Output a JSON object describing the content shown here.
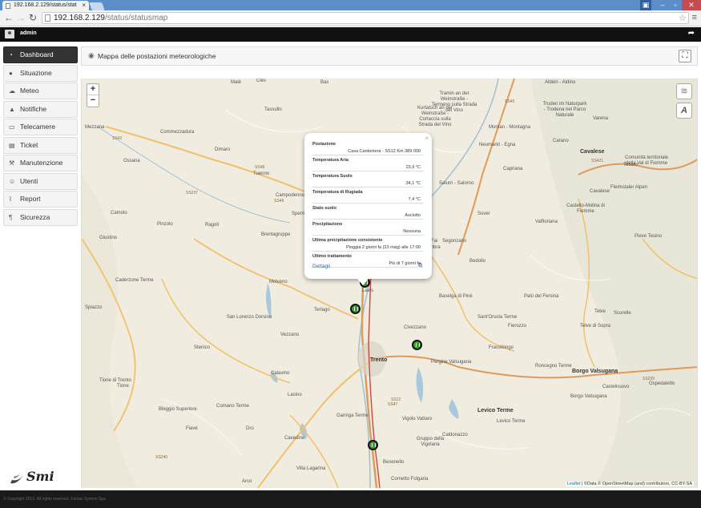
{
  "browser": {
    "tab_title": "192.168.2.129/status/stat",
    "tab_close": "×",
    "url_host": "192.168.2.129",
    "url_path": "/status/statusmap"
  },
  "app": {
    "username": "admin"
  },
  "sidebar": {
    "items": [
      {
        "label": "Dashboard",
        "icon": "dashboard-icon",
        "glyph": "◔"
      },
      {
        "label": "Situazione",
        "icon": "map-pin-icon",
        "glyph": "●"
      },
      {
        "label": "Meteo",
        "icon": "cloud-icon",
        "glyph": "☁"
      },
      {
        "label": "Notifiche",
        "icon": "warning-icon",
        "glyph": "▲"
      },
      {
        "label": "Telecamere",
        "icon": "camera-icon",
        "glyph": "▭"
      },
      {
        "label": "Ticket",
        "icon": "ticket-icon",
        "glyph": "▤"
      },
      {
        "label": "Manutenzione",
        "icon": "tools-icon",
        "glyph": "⚒"
      },
      {
        "label": "Utenti",
        "icon": "users-icon",
        "glyph": "☺"
      },
      {
        "label": "Report",
        "icon": "chart-icon",
        "glyph": "⌇"
      },
      {
        "label": "Sicurezza",
        "icon": "shield-icon",
        "glyph": "¶"
      }
    ]
  },
  "brand": {
    "name": "Smi"
  },
  "panel": {
    "title": "Mappa delle postazioni meteorologiche"
  },
  "map": {
    "zoom_in": "+",
    "zoom_out": "−",
    "places": [
      {
        "name": "Malé",
        "cls": ""
      },
      {
        "name": "Cles",
        "cls": ""
      },
      {
        "name": "Tassullo",
        "cls": ""
      },
      {
        "name": "Dimaro",
        "cls": ""
      },
      {
        "name": "Commezzadura",
        "cls": ""
      },
      {
        "name": "Mezzana",
        "cls": ""
      },
      {
        "name": "Ossana",
        "cls": ""
      },
      {
        "name": "Tuenno",
        "cls": ""
      },
      {
        "name": "Campodenno",
        "cls": ""
      },
      {
        "name": "Camolo",
        "cls": ""
      },
      {
        "name": "Pinzolo",
        "cls": ""
      },
      {
        "name": "Ragoli",
        "cls": ""
      },
      {
        "name": "Brentagruppe",
        "cls": ""
      },
      {
        "name": "Giustino",
        "cls": ""
      },
      {
        "name": "Caderzone Terme",
        "cls": ""
      },
      {
        "name": "Molveno",
        "cls": ""
      },
      {
        "name": "Spiazzo",
        "cls": ""
      },
      {
        "name": "Terlago",
        "cls": ""
      },
      {
        "name": "San Lorenzo Dorsino",
        "cls": ""
      },
      {
        "name": "Stenico",
        "cls": ""
      },
      {
        "name": "Vezzano",
        "cls": ""
      },
      {
        "name": "Trento",
        "cls": "big"
      },
      {
        "name": "Lavis",
        "cls": ""
      },
      {
        "name": "Civezzano",
        "cls": ""
      },
      {
        "name": "Tione di Trento",
        "cls": ""
      },
      {
        "name": "Tione",
        "cls": ""
      },
      {
        "name": "Calavino",
        "cls": ""
      },
      {
        "name": "Lasino",
        "cls": ""
      },
      {
        "name": "Bleggio Superiore",
        "cls": ""
      },
      {
        "name": "Fiavé",
        "cls": ""
      },
      {
        "name": "Comano Terme",
        "cls": ""
      },
      {
        "name": "Dro",
        "cls": ""
      },
      {
        "name": "Cavedine",
        "cls": ""
      },
      {
        "name": "Garniga Terme",
        "cls": ""
      },
      {
        "name": "Villa Lagarina",
        "cls": ""
      },
      {
        "name": "Arco",
        "cls": ""
      },
      {
        "name": "Besenello",
        "cls": ""
      },
      {
        "name": "Cornetto Folgaria",
        "cls": ""
      },
      {
        "name": "Vigolo Vattaro",
        "cls": ""
      },
      {
        "name": "Gruppo della Vigolana",
        "cls": ""
      },
      {
        "name": "Caldonazzo",
        "cls": ""
      },
      {
        "name": "Levico Terme",
        "cls": "big"
      },
      {
        "name": "Levico Terme",
        "cls": ""
      },
      {
        "name": "Pergine Valsugana",
        "cls": ""
      },
      {
        "name": "Frassilongo",
        "cls": ""
      },
      {
        "name": "Roncegno Terme",
        "cls": ""
      },
      {
        "name": "Borgo Valsugana",
        "cls": "big"
      },
      {
        "name": "Borgo Valsugana",
        "cls": ""
      },
      {
        "name": "Castelnuovo",
        "cls": ""
      },
      {
        "name": "Ospedaletto",
        "cls": ""
      },
      {
        "name": "Telve",
        "cls": ""
      },
      {
        "name": "Telve di Sopra",
        "cls": ""
      },
      {
        "name": "Scurelle",
        "cls": ""
      },
      {
        "name": "Palù del Fersina",
        "cls": ""
      },
      {
        "name": "Fierozzo",
        "cls": ""
      },
      {
        "name": "Sant'Orsola Terme",
        "cls": ""
      },
      {
        "name": "Baselga di Pinè",
        "cls": ""
      },
      {
        "name": "Bedollo",
        "cls": ""
      },
      {
        "name": "Segonzano",
        "cls": ""
      },
      {
        "name": "Pieve Tesino",
        "cls": ""
      },
      {
        "name": "Valfloriana",
        "cls": ""
      },
      {
        "name": "Castello-Molina di Fiemme",
        "cls": ""
      },
      {
        "name": "Sover",
        "cls": ""
      },
      {
        "name": "Cavalese",
        "cls": ""
      },
      {
        "name": "Fleimstaler Alpen",
        "cls": ""
      },
      {
        "name": "Comunità territoriale della Val di Fiemme",
        "cls": ""
      },
      {
        "name": "Tesero",
        "cls": ""
      },
      {
        "name": "Capriana",
        "cls": ""
      },
      {
        "name": "Cavalese",
        "cls": "big"
      },
      {
        "name": "Carano",
        "cls": ""
      },
      {
        "name": "Varena",
        "cls": ""
      },
      {
        "name": "Truden im Naturpark - Trodena nel Parco Naturale",
        "cls": ""
      },
      {
        "name": "Montan - Montagna",
        "cls": ""
      },
      {
        "name": "Neumarkt - Egna",
        "cls": ""
      },
      {
        "name": "Salurn - Salorno",
        "cls": ""
      },
      {
        "name": "Tramin an der Weinstraße - Termeno sulla Strada del Vino",
        "cls": ""
      },
      {
        "name": "Kurtatsch an der Weinstraße - Cortaccia sulla Strada del Vino",
        "cls": ""
      },
      {
        "name": "Aldein - Aldino",
        "cls": ""
      },
      {
        "name": "Bas",
        "cls": ""
      },
      {
        "name": "Fai",
        "cls": ""
      },
      {
        "name": "Sperm",
        "cls": ""
      },
      {
        "name": "mbra",
        "cls": ""
      }
    ],
    "popup": {
      "close": "×",
      "rows": [
        {
          "label": "Postazione",
          "value": "Casa Cantoniera - SS12 Km 389 000"
        },
        {
          "label": "Temperatura Aria",
          "value": "23,9 °C"
        },
        {
          "label": "Temperatura Suolo",
          "value": "34,1 °C"
        },
        {
          "label": "Temperatura di Rugiada",
          "value": "7,4 °C"
        },
        {
          "label": "Stato suolo",
          "value": "Asciutto"
        },
        {
          "label": "Precipitazione",
          "value": "Nessuna"
        },
        {
          "label": "Ultima precipitazione consistente",
          "value": "Pioggia 2 giorni fa (23 mag) alle 17:00"
        },
        {
          "label": "Ultimo trattamento",
          "value": "Più di 7 giorni fa"
        }
      ],
      "details_link": "Dettagli"
    },
    "attribution_leaflet": "Leaflet",
    "attribution_text": " | ©Data © OpenStreetMap (and) contributors, CC-BY-SA",
    "road_labels": [
      "SS42",
      "SS48",
      "SS47",
      "SS12",
      "SS45",
      "SS237",
      "SS421",
      "SS239",
      "SS240",
      "SS48",
      "SS612"
    ]
  },
  "footer": {
    "copyright": "© Copyright 2013. All rights reserved. Famas System Spa"
  }
}
